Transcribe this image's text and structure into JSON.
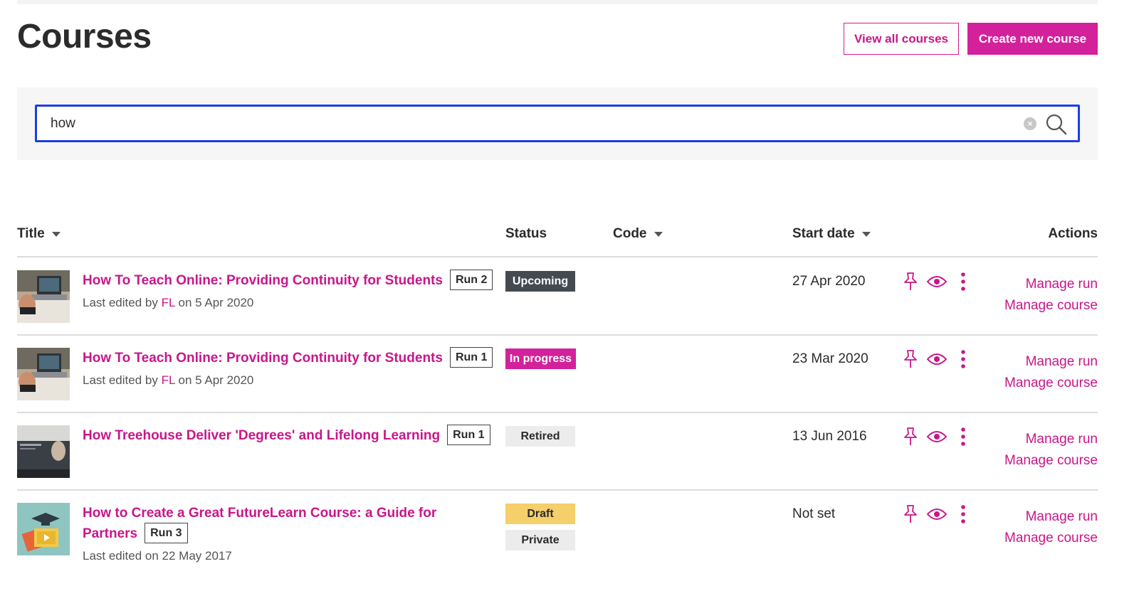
{
  "page": {
    "title": "Courses"
  },
  "header": {
    "view_all_label": "View all courses",
    "create_label": "Create new course"
  },
  "search": {
    "value": "how",
    "clear_glyph": "×",
    "clear_icon": "clear-icon",
    "search_icon": "search-icon"
  },
  "table": {
    "columns": {
      "title": "Title",
      "status": "Status",
      "code": "Code",
      "start_date": "Start date",
      "actions": "Actions"
    },
    "rows": [
      {
        "title": "How To Teach Online: Providing Continuity for Students",
        "run": "Run 2",
        "edited_prefix": "Last edited by ",
        "edited_user": "FL",
        "edited_suffix": " on 5 Apr 2020",
        "status": "Upcoming",
        "start_date": "27 Apr 2020",
        "manage_run": "Manage run",
        "manage_course": "Manage course"
      },
      {
        "title": "How To Teach Online: Providing Continuity for Students",
        "run": "Run 1",
        "edited_prefix": "Last edited by ",
        "edited_user": "FL",
        "edited_suffix": " on 5 Apr 2020",
        "status": "In progress",
        "start_date": "23 Mar 2020",
        "manage_run": "Manage run",
        "manage_course": "Manage course"
      },
      {
        "title": "How Treehouse Deliver 'Degrees' and Lifelong Learning",
        "run": "Run 1",
        "status": "Retired",
        "start_date": "13 Jun 2016",
        "manage_run": "Manage run",
        "manage_course": "Manage course"
      },
      {
        "title": "How to Create a Great FutureLearn Course: a Guide for Partners",
        "run": "Run 3",
        "edited_text": "Last edited on 22 May 2017",
        "status": "Draft",
        "status2": "Private",
        "start_date": "Not set",
        "manage_run": "Manage run",
        "manage_course": "Manage course"
      }
    ]
  },
  "colors": {
    "brand": "#d3219b",
    "link": "#c9168a",
    "focus": "#1a3ee8"
  },
  "icons": {
    "pin": "pin-icon",
    "preview": "eye-icon",
    "more": "more-vertical-icon"
  }
}
